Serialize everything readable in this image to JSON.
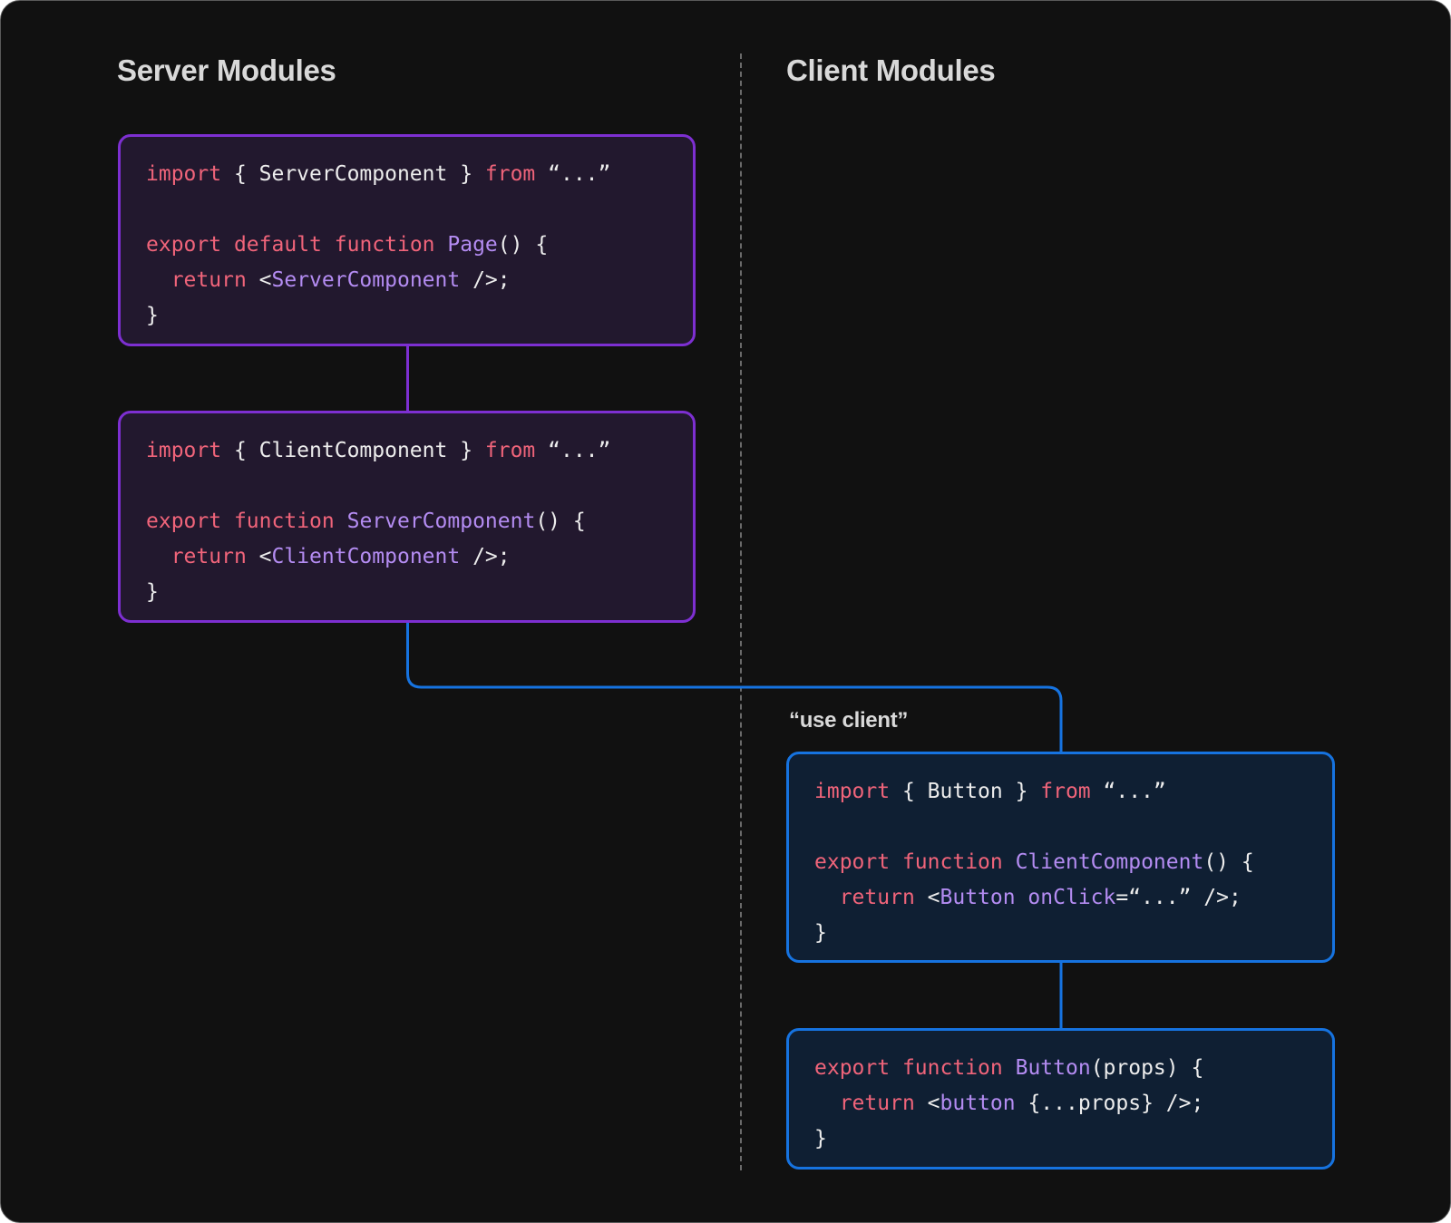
{
  "headings": {
    "server": "Server Modules",
    "client": "Client Modules"
  },
  "directive_label": "“use client”",
  "colors": {
    "background": "#111111",
    "server_border": "#7d2fd1",
    "server_fill": "#22182e",
    "client_border": "#1673e0",
    "client_fill": "#0f1f33",
    "keyword": "#f0647a",
    "identifier": "#b48cf2",
    "plain": "#ededed"
  },
  "boxes": [
    {
      "id": "page",
      "side": "server",
      "lines": [
        [
          {
            "t": "kw",
            "v": "import"
          },
          {
            "t": "pl",
            "v": " { ServerComponent } "
          },
          {
            "t": "kw",
            "v": "from"
          },
          {
            "t": "pl",
            "v": " “...”"
          }
        ],
        [],
        [
          {
            "t": "kw",
            "v": "export"
          },
          {
            "t": "pl",
            "v": " "
          },
          {
            "t": "kw",
            "v": "default"
          },
          {
            "t": "pl",
            "v": " "
          },
          {
            "t": "kw",
            "v": "function"
          },
          {
            "t": "pl",
            "v": " "
          },
          {
            "t": "fn",
            "v": "Page"
          },
          {
            "t": "pl",
            "v": "() {"
          }
        ],
        [
          {
            "t": "pl",
            "v": "  "
          },
          {
            "t": "kw",
            "v": "return"
          },
          {
            "t": "pl",
            "v": " <"
          },
          {
            "t": "fn",
            "v": "ServerComponent"
          },
          {
            "t": "pl",
            "v": " />;"
          }
        ],
        [
          {
            "t": "pl",
            "v": "}"
          }
        ]
      ]
    },
    {
      "id": "server-component",
      "side": "server",
      "lines": [
        [
          {
            "t": "kw",
            "v": "import"
          },
          {
            "t": "pl",
            "v": " { ClientComponent } "
          },
          {
            "t": "kw",
            "v": "from"
          },
          {
            "t": "pl",
            "v": " “...”"
          }
        ],
        [],
        [
          {
            "t": "kw",
            "v": "export"
          },
          {
            "t": "pl",
            "v": " "
          },
          {
            "t": "kw",
            "v": "function"
          },
          {
            "t": "pl",
            "v": " "
          },
          {
            "t": "fn",
            "v": "ServerComponent"
          },
          {
            "t": "pl",
            "v": "() {"
          }
        ],
        [
          {
            "t": "pl",
            "v": "  "
          },
          {
            "t": "kw",
            "v": "return"
          },
          {
            "t": "pl",
            "v": " <"
          },
          {
            "t": "fn",
            "v": "ClientComponent"
          },
          {
            "t": "pl",
            "v": " />;"
          }
        ],
        [
          {
            "t": "pl",
            "v": "}"
          }
        ]
      ]
    },
    {
      "id": "client-component",
      "side": "client",
      "lines": [
        [
          {
            "t": "kw",
            "v": "import"
          },
          {
            "t": "pl",
            "v": " { Button } "
          },
          {
            "t": "kw",
            "v": "from"
          },
          {
            "t": "pl",
            "v": " “...”"
          }
        ],
        [],
        [
          {
            "t": "kw",
            "v": "export"
          },
          {
            "t": "pl",
            "v": " "
          },
          {
            "t": "kw",
            "v": "function"
          },
          {
            "t": "pl",
            "v": " "
          },
          {
            "t": "fn",
            "v": "ClientComponent"
          },
          {
            "t": "pl",
            "v": "() {"
          }
        ],
        [
          {
            "t": "pl",
            "v": "  "
          },
          {
            "t": "kw",
            "v": "return"
          },
          {
            "t": "pl",
            "v": " <"
          },
          {
            "t": "fn",
            "v": "Button onClick"
          },
          {
            "t": "pl",
            "v": "=“...” />;"
          }
        ],
        [
          {
            "t": "pl",
            "v": "}"
          }
        ]
      ]
    },
    {
      "id": "button",
      "side": "client",
      "lines": [
        [
          {
            "t": "kw",
            "v": "export"
          },
          {
            "t": "pl",
            "v": " "
          },
          {
            "t": "kw",
            "v": "function"
          },
          {
            "t": "pl",
            "v": " "
          },
          {
            "t": "fn",
            "v": "Button"
          },
          {
            "t": "pl",
            "v": "(props) {"
          }
        ],
        [
          {
            "t": "pl",
            "v": "  "
          },
          {
            "t": "kw",
            "v": "return"
          },
          {
            "t": "pl",
            "v": " <"
          },
          {
            "t": "fn",
            "v": "button"
          },
          {
            "t": "pl",
            "v": " {...props} />;"
          }
        ],
        [
          {
            "t": "pl",
            "v": "}"
          }
        ]
      ]
    }
  ]
}
